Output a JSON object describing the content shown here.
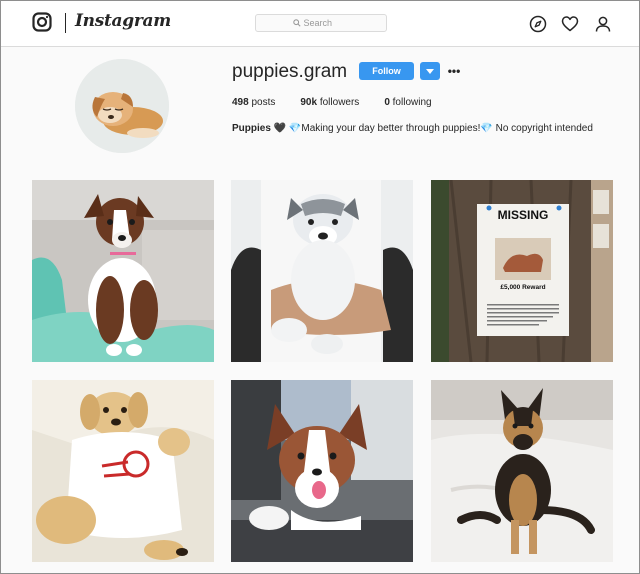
{
  "header": {
    "brand": "Instagram",
    "search_placeholder": "Search",
    "icons": [
      "instagram-glyph-icon",
      "compass-icon",
      "heart-icon",
      "person-icon"
    ]
  },
  "profile": {
    "username": "puppies.gram",
    "follow_label": "Follow",
    "more_label": "•••",
    "stats": {
      "posts_count": "498",
      "posts_label": "posts",
      "followers_count": "90k",
      "followers_label": "followers",
      "following_count": "0",
      "following_label": "following"
    },
    "bio_name": "Puppies",
    "bio_text": "🖤 💎Making your day better through puppies!💎 No copyright intended"
  },
  "posts": [
    {
      "subject": "border collie puppy on couch"
    },
    {
      "subject": "husky puppy held in arms"
    },
    {
      "subject": "missing dog poster on tree",
      "poster_title": "MISSING",
      "poster_reward": "£5,000 Reward",
      "poster_text": "For any information leading to safe return of our beloved family dog. Last seen by Acton fountain in Hyde Park on Thursday 18th May at 9am. Please call 020 3337 5974"
    },
    {
      "subject": "golden retriever puppy in shirt"
    },
    {
      "subject": "husky puppy in car"
    },
    {
      "subject": "german shepherd puppy on bed"
    }
  ]
}
